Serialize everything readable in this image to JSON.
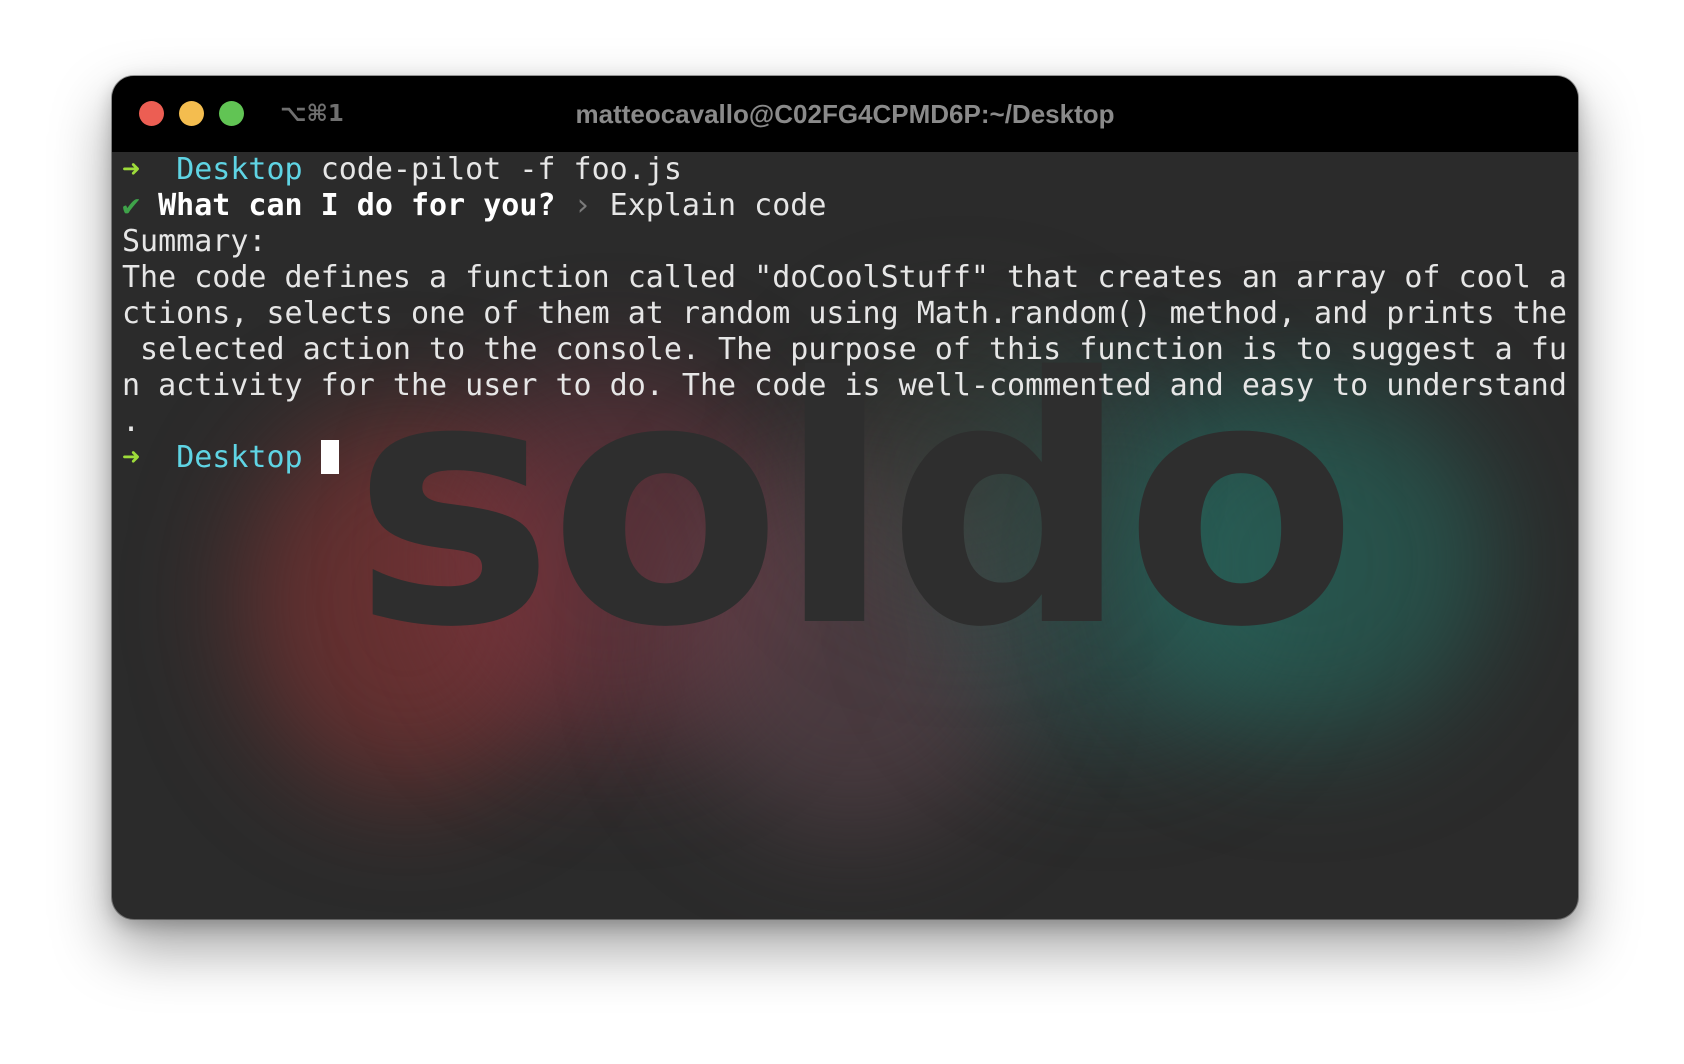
{
  "window": {
    "shortcut": "⌥⌘1",
    "title": "matteocavallo@C02FG4CPMD6P:~/Desktop"
  },
  "background": {
    "logo_text": "soldo",
    "logo_color": "#2e2e2e"
  },
  "terminal": {
    "prompt_arrow": "➜",
    "prompt_dir": "Desktop",
    "command": "code-pilot -f foo.js",
    "check_mark": "✔",
    "question": "What can I do for you?",
    "question_separator": "›",
    "answer": "Explain code",
    "summary_label": "Summary:",
    "summary_lines": [
      "The code defines a function called \"doCoolStuff\" that creates an array of cool a",
      "ctions, selects one of them at random using Math.random() method, and prints the",
      " selected action to the console. The purpose of this function is to suggest a fu",
      "n activity for the user to do. The code is well-commented and easy to understand",
      "."
    ]
  },
  "colors": {
    "prompt_arrow": "#9ddb3a",
    "prompt_dir": "#5fd4e4",
    "check": "#3fa34a",
    "terminal_bg": "#2b2b2b",
    "titlebar_bg": "#000000"
  }
}
